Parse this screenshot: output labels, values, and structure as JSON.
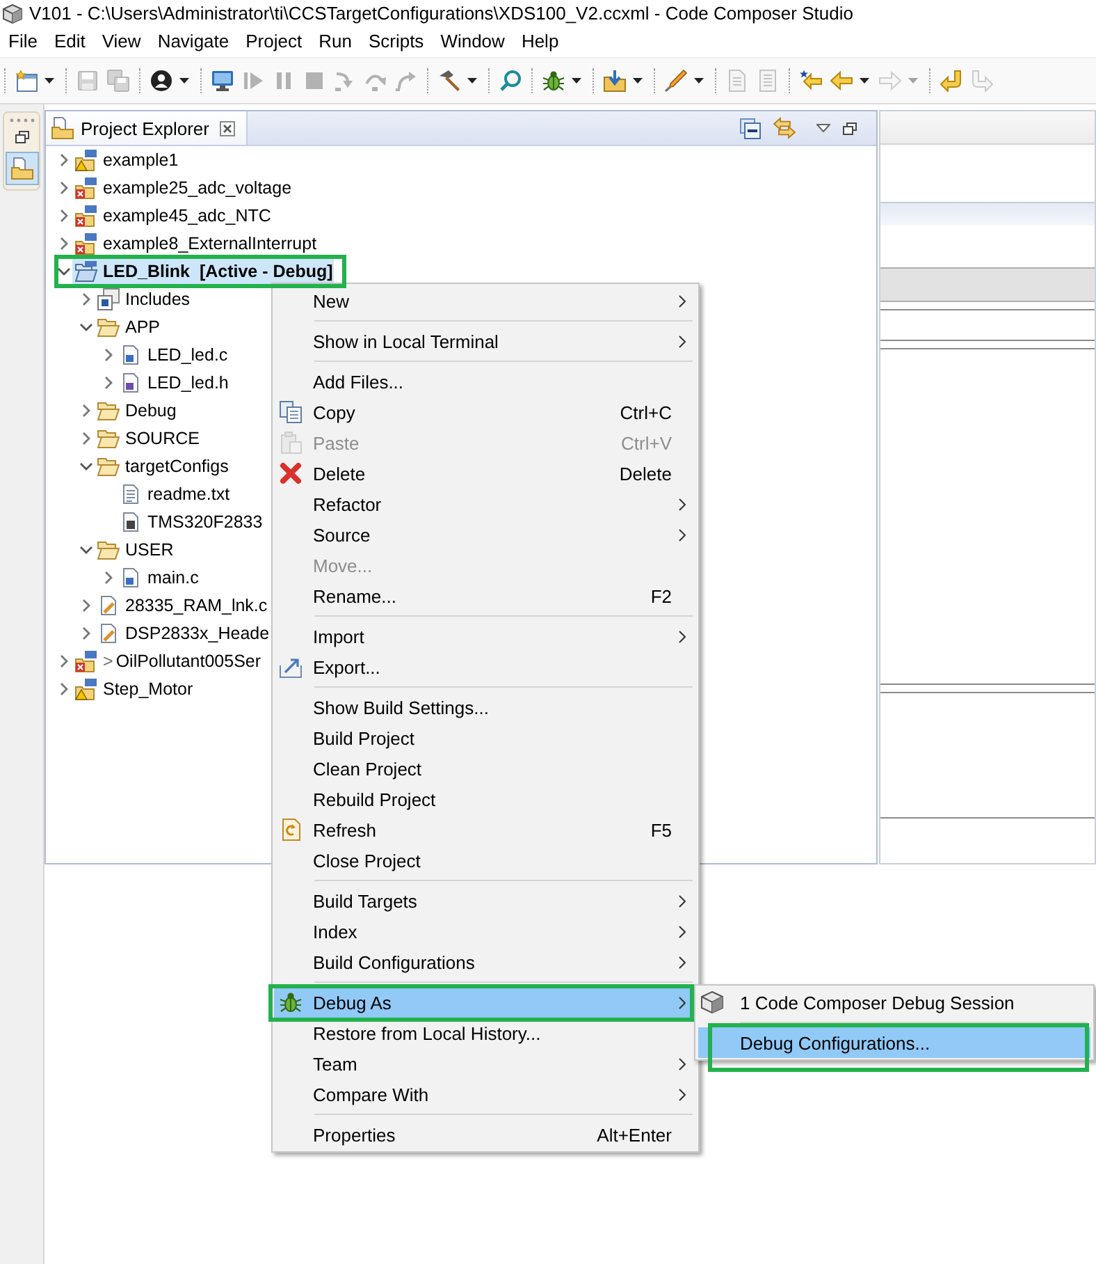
{
  "window": {
    "title": "V101 - C:\\Users\\Administrator\\ti\\CCSTargetConfigurations\\XDS100_V2.ccxml - Code Composer Studio"
  },
  "menu_bar": [
    "File",
    "Edit",
    "View",
    "Navigate",
    "Project",
    "Run",
    "Scripts",
    "Window",
    "Help"
  ],
  "toolbar": {
    "groups": [
      [
        {
          "disabled": false,
          "dropdown": true
        }
      ],
      [
        {
          "disabled": true,
          "dropdown": false
        },
        {
          "disabled": true,
          "dropdown": false
        }
      ],
      [
        {
          "disabled": false,
          "dropdown": true
        }
      ],
      [
        {
          "disabled": false,
          "dropdown": false
        },
        {
          "disabled": true,
          "dropdown": false
        },
        {
          "disabled": true,
          "dropdown": false
        },
        {
          "disabled": true,
          "dropdown": false
        },
        {
          "disabled": true,
          "dropdown": false
        },
        {
          "disabled": true,
          "dropdown": false
        },
        {
          "disabled": true,
          "dropdown": false
        }
      ],
      [
        {
          "disabled": false,
          "dropdown": true
        }
      ],
      [
        {
          "disabled": false,
          "dropdown": false
        }
      ],
      [
        {
          "disabled": false,
          "dropdown": true
        }
      ],
      [
        {
          "disabled": false,
          "dropdown": true
        }
      ],
      [
        {
          "disabled": false,
          "dropdown": true
        }
      ],
      [
        {
          "disabled": true,
          "dropdown": false
        },
        {
          "disabled": true,
          "dropdown": false
        }
      ],
      [
        {
          "disabled": false,
          "dropdown": false
        },
        {
          "disabled": false,
          "dropdown": true
        },
        {
          "disabled": true,
          "dropdown": true
        }
      ],
      [
        {
          "disabled": false,
          "dropdown": false
        },
        {
          "disabled": true,
          "dropdown": false
        }
      ]
    ]
  },
  "left_trim": {
    "view_button": {
      "selected": true
    }
  },
  "project_explorer": {
    "tab": {
      "title": "Project Explorer",
      "selected": true
    },
    "tree": [
      {
        "label": "example1",
        "kind": "project",
        "warning": true,
        "error": false,
        "expanded": false,
        "selected": false,
        "framed": false
      },
      {
        "label": "example25_adc_voltage",
        "kind": "project",
        "warning": false,
        "error": true,
        "expanded": false,
        "selected": false,
        "framed": false
      },
      {
        "label": "example45_adc_NTC",
        "kind": "project",
        "warning": false,
        "error": true,
        "expanded": false,
        "selected": false,
        "framed": false
      },
      {
        "label": "example8_ExternalInterrupt",
        "kind": "project",
        "warning": false,
        "error": true,
        "expanded": false,
        "selected": false,
        "framed": false
      },
      {
        "label": "LED_Blink  [Active - Debug]",
        "kind": "active-project",
        "warning": false,
        "error": false,
        "expanded": true,
        "selected": true,
        "framed": true,
        "children": [
          {
            "label": "Includes",
            "kind": "includes",
            "expanded": false,
            "selected": false,
            "framed": false
          },
          {
            "label": "APP",
            "kind": "folder",
            "expanded": true,
            "selected": false,
            "framed": false,
            "children": [
              {
                "label": "LED_led.c",
                "kind": "c-file",
                "expanded": false,
                "selected": false,
                "framed": false
              },
              {
                "label": "LED_led.h",
                "kind": "h-file",
                "expanded": false,
                "selected": false,
                "framed": false
              }
            ]
          },
          {
            "label": "Debug",
            "kind": "folder",
            "expanded": false,
            "selected": false,
            "framed": false
          },
          {
            "label": "SOURCE",
            "kind": "folder",
            "expanded": false,
            "selected": false,
            "framed": false
          },
          {
            "label": "targetConfigs",
            "kind": "folder",
            "expanded": true,
            "selected": false,
            "framed": false,
            "children": [
              {
                "label": "readme.txt",
                "kind": "text-file",
                "selected": false,
                "framed": false
              },
              {
                "label": "TMS320F2833",
                "kind": "target-file",
                "selected": false,
                "framed": false
              }
            ]
          },
          {
            "label": "USER",
            "kind": "folder",
            "expanded": true,
            "selected": false,
            "framed": false,
            "children": [
              {
                "label": "main.c",
                "kind": "c-file",
                "expanded": false,
                "selected": false,
                "framed": false
              }
            ]
          },
          {
            "label": "28335_RAM_lnk.c",
            "kind": "linker-file",
            "expanded": false,
            "selected": false,
            "framed": false
          },
          {
            "label": "DSP2833x_Heade",
            "kind": "linker-file",
            "expanded": false,
            "selected": false,
            "framed": false
          }
        ]
      },
      {
        "label": "OilPollutant005Ser",
        "prefix": ">",
        "kind": "project",
        "warning": false,
        "error": true,
        "expanded": false,
        "selected": false,
        "framed": false
      },
      {
        "label": "Step_Motor",
        "kind": "project",
        "warning": true,
        "error": false,
        "expanded": false,
        "selected": false,
        "framed": false
      }
    ]
  },
  "context_menu": {
    "groups": [
      [
        {
          "label": "New",
          "submenu": true,
          "disabled": false,
          "selected": false,
          "framed": false
        }
      ],
      [
        {
          "label": "Show in Local Terminal",
          "submenu": true,
          "disabled": false,
          "selected": false,
          "framed": false
        }
      ],
      [
        {
          "label": "Add Files...",
          "submenu": false,
          "disabled": false,
          "selected": false,
          "framed": false
        },
        {
          "label": "Copy",
          "shortcut": "Ctrl+C",
          "submenu": false,
          "disabled": false,
          "selected": false,
          "framed": false
        },
        {
          "label": "Paste",
          "shortcut": "Ctrl+V",
          "submenu": false,
          "disabled": true,
          "selected": false,
          "framed": false
        },
        {
          "label": "Delete",
          "shortcut": "Delete",
          "submenu": false,
          "disabled": false,
          "selected": false,
          "framed": false
        },
        {
          "label": "Refactor",
          "submenu": true,
          "disabled": false,
          "selected": false,
          "framed": false
        },
        {
          "label": "Source",
          "submenu": true,
          "disabled": false,
          "selected": false,
          "framed": false
        },
        {
          "label": "Move...",
          "submenu": false,
          "disabled": true,
          "selected": false,
          "framed": false
        },
        {
          "label": "Rename...",
          "shortcut": "F2",
          "submenu": false,
          "disabled": false,
          "selected": false,
          "framed": false
        }
      ],
      [
        {
          "label": "Import",
          "submenu": true,
          "disabled": false,
          "selected": false,
          "framed": false
        },
        {
          "label": "Export...",
          "submenu": false,
          "disabled": false,
          "selected": false,
          "framed": false
        }
      ],
      [
        {
          "label": "Show Build Settings...",
          "submenu": false,
          "disabled": false,
          "selected": false,
          "framed": false
        },
        {
          "label": "Build Project",
          "submenu": false,
          "disabled": false,
          "selected": false,
          "framed": false
        },
        {
          "label": "Clean Project",
          "submenu": false,
          "disabled": false,
          "selected": false,
          "framed": false
        },
        {
          "label": "Rebuild Project",
          "submenu": false,
          "disabled": false,
          "selected": false,
          "framed": false
        },
        {
          "label": "Refresh",
          "shortcut": "F5",
          "submenu": false,
          "disabled": false,
          "selected": false,
          "framed": false
        },
        {
          "label": "Close Project",
          "submenu": false,
          "disabled": false,
          "selected": false,
          "framed": false
        }
      ],
      [
        {
          "label": "Build Targets",
          "submenu": true,
          "disabled": false,
          "selected": false,
          "framed": false
        },
        {
          "label": "Index",
          "submenu": true,
          "disabled": false,
          "selected": false,
          "framed": false
        },
        {
          "label": "Build Configurations",
          "submenu": true,
          "disabled": false,
          "selected": false,
          "framed": false
        }
      ],
      [
        {
          "label": "Debug As",
          "submenu": true,
          "disabled": false,
          "selected": true,
          "framed": true
        },
        {
          "label": "Restore from Local History...",
          "submenu": false,
          "disabled": false,
          "selected": false,
          "framed": false
        },
        {
          "label": "Team",
          "submenu": true,
          "disabled": false,
          "selected": false,
          "framed": false
        },
        {
          "label": "Compare With",
          "submenu": true,
          "disabled": false,
          "selected": false,
          "framed": false
        }
      ],
      [
        {
          "label": "Properties",
          "shortcut": "Alt+Enter",
          "submenu": false,
          "disabled": false,
          "selected": false,
          "framed": false
        }
      ]
    ],
    "submenu": {
      "groups": [
        [
          {
            "label": "1 Code Composer Debug Session",
            "selected": false,
            "framed": false
          }
        ],
        [
          {
            "label": "Debug Configurations...",
            "selected": true,
            "framed": true
          }
        ]
      ]
    }
  }
}
